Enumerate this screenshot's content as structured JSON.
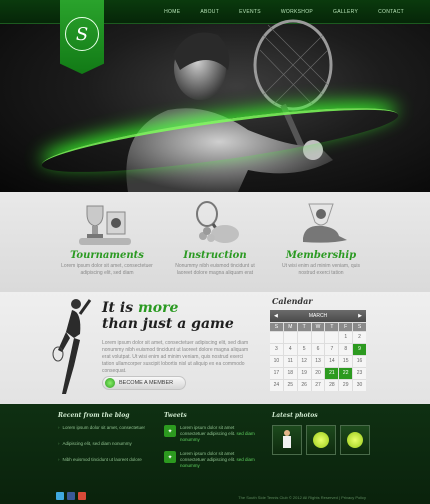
{
  "nav": [
    "HOME",
    "ABOUT",
    "EVENTS",
    "WORKSHOP",
    "GALLERY",
    "CONTACT"
  ],
  "logo": {
    "letter": "S",
    "ring_text": "THE SOUTH SIDE TENNIS CLUB"
  },
  "features": [
    {
      "title": "Tournaments",
      "text": "Lorem ipsum dolor sit amet, consectetuer adipiscing elit, sed diam"
    },
    {
      "title": "Instruction",
      "text": "Nonummy nibh euismod tincidunt ut laoreet dolore magna aliquam erat"
    },
    {
      "title": "Membership",
      "text": "Ut wisi enim ad minim veniam, quis nostrud exerci tation"
    }
  ],
  "headline": {
    "line1_a": "It is ",
    "line1_b": "more",
    "line2": "than just a game"
  },
  "body_text": "Lorem ipsum dolor sit amet, consectetuer adipiscing elit, sed diam nonummy nibh euismod tincidunt ut laoreet dolore magna aliquam erat volutpat. Ut wisi enim ad minim veniam, quis nostrud exerci tation ullamcorper suscipit lobortis nisl ut aliquip ex ea commodo consequat.",
  "member_button": "BECOME A MEMBER",
  "calendar": {
    "title": "Calendar",
    "month": "MARCH",
    "days": [
      "",
      "",
      "",
      "",
      "",
      "1",
      "2",
      "3",
      "4",
      "5",
      "6",
      "7",
      "8",
      "9",
      "10",
      "11",
      "12",
      "13",
      "14",
      "15",
      "16",
      "17",
      "18",
      "19",
      "20",
      "21",
      "22",
      "23",
      "24",
      "25",
      "26",
      "27",
      "28",
      "29",
      "30"
    ],
    "highlight": [
      "9",
      "21",
      "22"
    ]
  },
  "footer": {
    "blog_title": "Recent from the blog",
    "blog_items": [
      "Lorem ipsum dolor sit amet, consectetuer",
      "Adipiscing elit, sed diam nonummy",
      "Nibh euismod tincidunt ut laoreet dolore"
    ],
    "tweets_title": "Tweets",
    "tweets": [
      {
        "text": "Lorem ipsum dolor sit amet consectetuer adipiscing elit.",
        "link": "sed diam nonummy"
      },
      {
        "text": "Lorem ipsum dolor sit amet consectetuer adipiscing elit.",
        "link": "sed diam nonummy"
      }
    ],
    "photos_title": "Latest photos",
    "copyright": "The South Side Tennis Club © 2012 All Rights Reserved | Privacy Policy"
  }
}
